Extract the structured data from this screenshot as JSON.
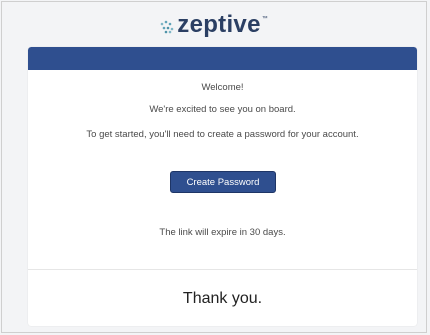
{
  "brand": {
    "name": "zeptive",
    "trademark": "™",
    "logo_dot_color": "#5fa3b8",
    "text_color": "#2b3f63"
  },
  "email": {
    "header_color": "#2f4f8f",
    "welcome": "Welcome!",
    "excited": "We're excited to see you on board.",
    "instructions": "To get started, you'll need to create a password for your account.",
    "button_label": "Create Password",
    "expire_note": "The link will expire in 30 days.",
    "thanks": "Thank you."
  }
}
